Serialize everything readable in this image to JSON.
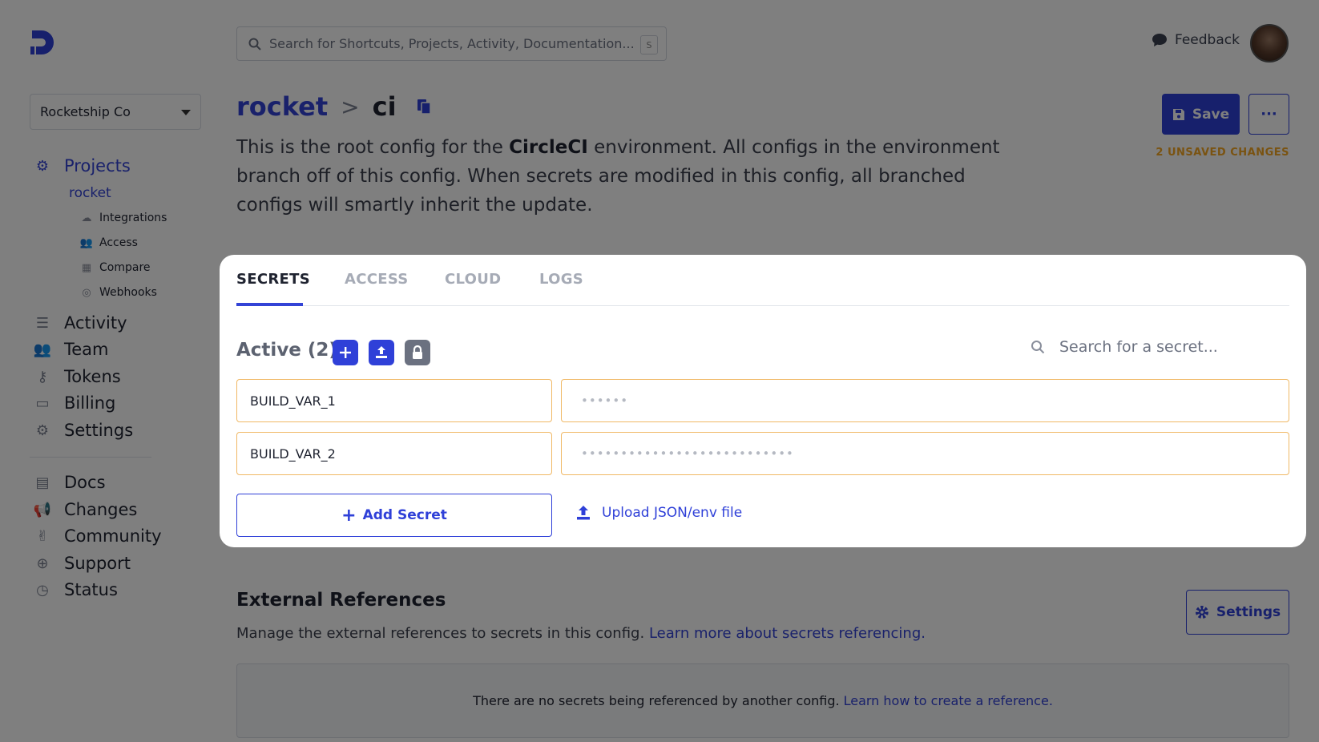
{
  "app": {
    "org": "Rocketship Co",
    "search_placeholder": "Search for Shortcuts, Projects, Activity, Documentation...",
    "search_shortcut": "S",
    "feedback_label": "Feedback"
  },
  "sidebar": {
    "projects_label": "Projects",
    "project_name": "rocket",
    "project_sub": [
      {
        "label": "Integrations",
        "icon": "cloud-icon"
      },
      {
        "label": "Access",
        "icon": "users-icon"
      },
      {
        "label": "Compare",
        "icon": "compare-icon"
      },
      {
        "label": "Webhooks",
        "icon": "broadcast-icon"
      }
    ],
    "main_items": [
      {
        "label": "Activity",
        "icon": "list-icon"
      },
      {
        "label": "Team",
        "icon": "team-icon"
      },
      {
        "label": "Tokens",
        "icon": "key-icon"
      },
      {
        "label": "Billing",
        "icon": "credit-card-icon"
      },
      {
        "label": "Settings",
        "icon": "gear-icon"
      }
    ],
    "secondary_items": [
      {
        "label": "Docs",
        "icon": "book-icon"
      },
      {
        "label": "Changes",
        "icon": "megaphone-icon"
      },
      {
        "label": "Community",
        "icon": "hand-icon"
      },
      {
        "label": "Support",
        "icon": "lifebuoy-icon"
      },
      {
        "label": "Status",
        "icon": "clock-icon"
      }
    ]
  },
  "header": {
    "breadcrumb_project": "rocket",
    "breadcrumb_separator": ">",
    "breadcrumb_config": "ci",
    "description_prefix": "This is the root config for the ",
    "description_bold": "CircleCI",
    "description_suffix": " environment. All configs in the environment branch off of this config. When secrets are modified in this config, all branched configs will smartly inherit the update.",
    "save_label": "Save",
    "more_label": "···",
    "unsaved_text": "2 UNSAVED CHANGES"
  },
  "card": {
    "tabs": [
      {
        "label": "SECRETS",
        "active": true
      },
      {
        "label": "ACCESS",
        "active": false
      },
      {
        "label": "CLOUD",
        "active": false
      },
      {
        "label": "LOGS",
        "active": false
      }
    ],
    "active_title": "Active (2)",
    "search_placeholder": "Search for a secret...",
    "secrets": [
      {
        "name": "BUILD_VAR_1",
        "value_masked": "••••••"
      },
      {
        "name": "BUILD_VAR_2",
        "value_masked": "•••••••••••••••••••••••••••"
      }
    ],
    "add_secret_label": "Add Secret",
    "upload_label": "Upload JSON/env file"
  },
  "external_refs": {
    "title": "External References",
    "desc": "Manage the external references to secrets in this config.",
    "desc_link": "Learn more about secrets referencing.",
    "settings_label": "Settings",
    "empty_text": "There are no secrets being referenced by another config.",
    "empty_link": "Learn how to create a reference."
  },
  "colors": {
    "accent": "#2f40d8",
    "warning": "#f5a623",
    "overlay": "rgba(0,0,0,0.5)"
  }
}
